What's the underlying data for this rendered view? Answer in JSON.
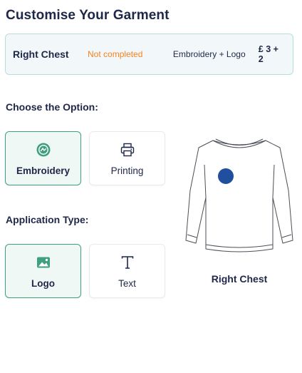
{
  "page": {
    "title": "Customise Your Garment"
  },
  "summary": {
    "location": "Right Chest",
    "status": "Not completed",
    "method": "Embroidery + Logo",
    "price": "£ 3 + 2"
  },
  "option_section": {
    "label": "Choose the Option:",
    "items": [
      {
        "label": "Embroidery",
        "icon": "embroidery-icon",
        "selected": true
      },
      {
        "label": "Printing",
        "icon": "printer-icon",
        "selected": false
      }
    ]
  },
  "application_section": {
    "label": "Application Type:",
    "items": [
      {
        "label": "Logo",
        "icon": "image-icon",
        "selected": true
      },
      {
        "label": "Text",
        "icon": "text-icon",
        "selected": false
      }
    ]
  },
  "preview": {
    "caption": "Right Chest"
  },
  "colors": {
    "accent": "#3fa07e",
    "warning": "#f5821f",
    "marker": "#1f4f9e",
    "text": "#1f2748"
  }
}
